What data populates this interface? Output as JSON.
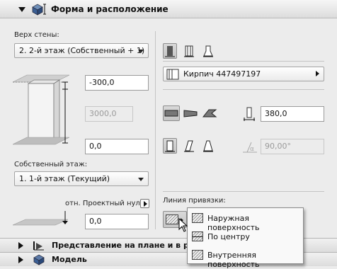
{
  "header": {
    "title": "Форма и расположение",
    "collapse_icon": "triangle-down",
    "section_icon": "cube-height-icon"
  },
  "left": {
    "top_wall_label": "Верх стены:",
    "top_wall_value": "2. 2-й этаж (Собственный + 1)",
    "offset_top": "-300,0",
    "height": "3000,0",
    "offset_bottom": "0,0",
    "home_story_label": "Собственный этаж:",
    "home_story_value": "1. 1-й этаж (Текущий)",
    "ref_level_label": "отн. Проектный нуль",
    "ref_level_value": "0,0"
  },
  "right": {
    "structure_buttons": [
      "basic-wall-icon",
      "composite-wall-icon",
      "profile-wall-icon"
    ],
    "material_value": "Кирпич 447497197",
    "geometry_buttons": [
      "straight-wall-icon",
      "trapezoid-wall-icon",
      "polygonal-wall-icon"
    ],
    "thickness_value": "380,0",
    "profile_buttons": [
      "vertical-wall-icon",
      "slanted-wall-icon",
      "double-slanted-wall-icon"
    ],
    "angle_value": "90,00°",
    "reference_line_label": "Линия привязки:"
  },
  "popup": {
    "items": [
      "Наружная поверхность",
      "По центру",
      "Внутренняя поверхность"
    ]
  },
  "sections": [
    {
      "title": "Представление на плане и в раз"
    },
    {
      "title": "Модель"
    }
  ]
}
